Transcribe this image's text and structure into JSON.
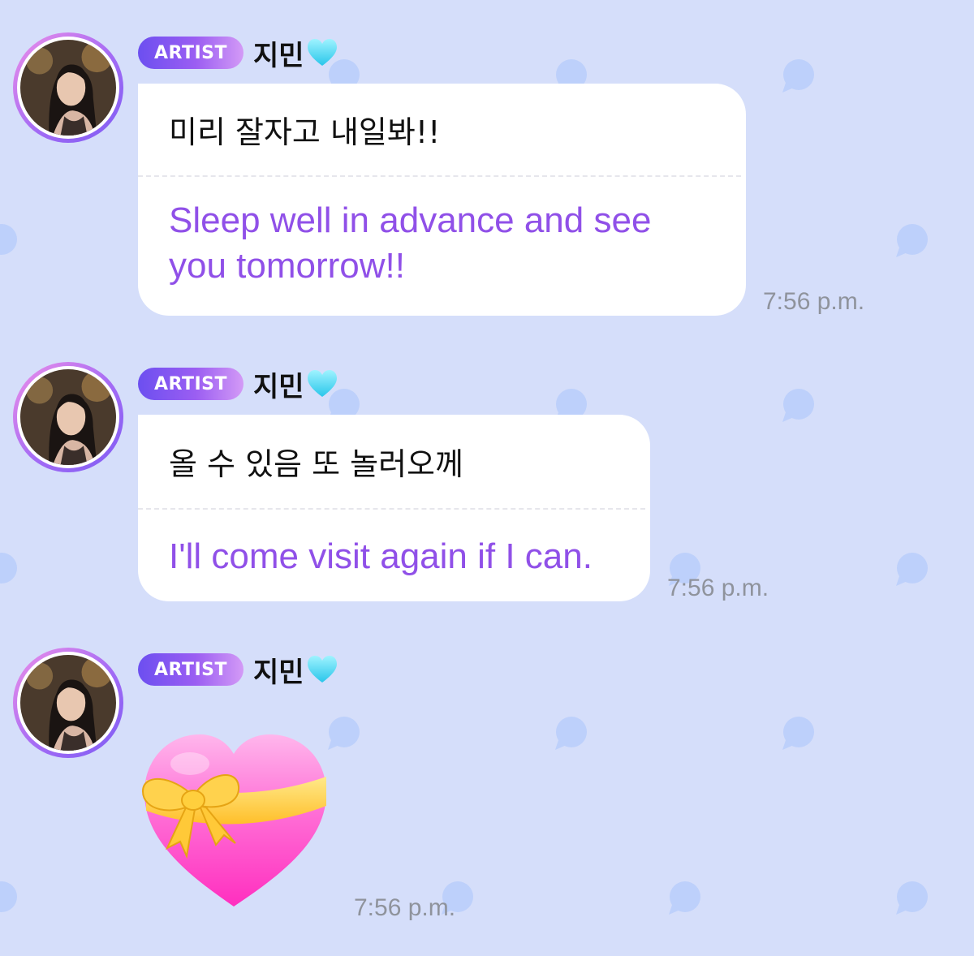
{
  "chat": {
    "messages": [
      {
        "badge": "ARTIST",
        "sender": "지민",
        "text_ko": "미리 잘자고 내일봐!!",
        "text_en": "Sleep well in advance and see you tomorrow!!",
        "time": "7:56 p.m."
      },
      {
        "badge": "ARTIST",
        "sender": "지민",
        "text_ko": "올 수 있음 또 놀러오께",
        "text_en": "I'll come visit again if I can.",
        "time": "7:56 p.m."
      },
      {
        "badge": "ARTIST",
        "sender": "지민",
        "emoji": "heart-with-ribbon",
        "time": "7:56 p.m."
      }
    ]
  },
  "icons": {
    "name_suffix": "light-blue-heart-icon",
    "background_pattern": "speech-bubble-icon"
  },
  "colors": {
    "background": "#d5defa",
    "bubble": "#ffffff",
    "translation_text": "#9050e8",
    "badge_gradient_start": "#6c4ff0",
    "badge_gradient_end": "#d39af6",
    "timestamp": "#8f939c",
    "pattern_bubble": "#bdd0fb"
  }
}
